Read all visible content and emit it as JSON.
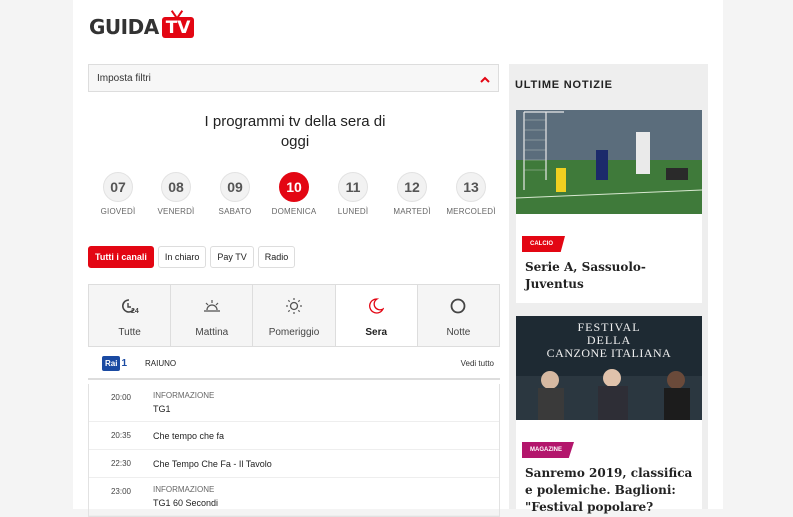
{
  "logo": {
    "text": "GUIDA",
    "tv": "TV"
  },
  "filter": {
    "label": "Imposta filtri",
    "toggle_icon": "chevron-up-icon"
  },
  "headline": "I programmi tv della sera di oggi",
  "days": [
    {
      "num": "07",
      "name": "GIOVEDÌ"
    },
    {
      "num": "08",
      "name": "VENERDÌ"
    },
    {
      "num": "09",
      "name": "SABATO"
    },
    {
      "num": "10",
      "name": "DOMENICA",
      "active": true
    },
    {
      "num": "11",
      "name": "LUNEDÌ"
    },
    {
      "num": "12",
      "name": "MARTEDÌ"
    },
    {
      "num": "13",
      "name": "MERCOLEDÌ"
    }
  ],
  "chips": [
    "Tutti i canali",
    "In chiaro",
    "Pay TV",
    "Radio"
  ],
  "tabs": [
    {
      "label": "Tutte",
      "icon": "clock-24-icon"
    },
    {
      "label": "Mattina",
      "icon": "sunrise-icon"
    },
    {
      "label": "Pomeriggio",
      "icon": "sun-icon"
    },
    {
      "label": "Sera",
      "icon": "moon-icon",
      "active": true
    },
    {
      "label": "Notte",
      "icon": "circle-icon"
    }
  ],
  "channel": {
    "logo": "Rai",
    "logo_num": "1",
    "name": "RAIUNO",
    "see_all": "Vedi tutto"
  },
  "listings": [
    {
      "time": "20:00",
      "category": "INFORMAZIONE",
      "title": "TG1"
    },
    {
      "time": "20:35",
      "category": "",
      "title": "Che tempo che fa"
    },
    {
      "time": "22:30",
      "category": "",
      "title": "Che Tempo Che Fa - Il Tavolo"
    },
    {
      "time": "23:00",
      "category": "INFORMAZIONE",
      "title": "TG1 60 Secondi"
    }
  ],
  "sidebar": {
    "heading": "ULTIME NOTIZIE",
    "cards": [
      {
        "tag": "CALCIO",
        "title": "Serie A, Sassuolo-Juventus"
      },
      {
        "tag": "MAGAZINE",
        "title": "Sanremo 2019, classifica e polemiche. Baglioni: \"Festival popolare?",
        "image_text": "FESTIVAL DELLA CANZONE ITALIANA"
      }
    ]
  },
  "colors": {
    "accent": "#e30613",
    "magazine": "#b3166c",
    "rai_blue": "#1a4aa2"
  }
}
